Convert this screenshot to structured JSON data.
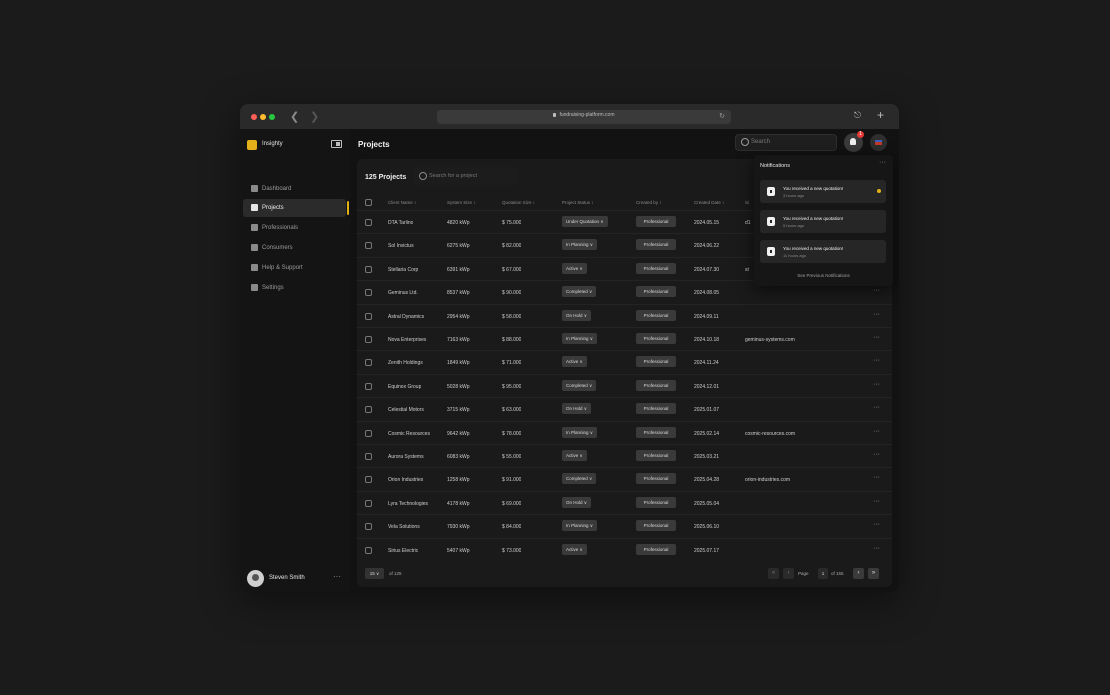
{
  "browser": {
    "url": "fundraising-platform.com"
  },
  "sidebar": {
    "brand": "Insighty",
    "items": [
      {
        "label": "Dashboard",
        "icon": "home-icon"
      },
      {
        "label": "Projects",
        "icon": "folder-icon",
        "active": true
      },
      {
        "label": "Professionals",
        "icon": "wrench-icon"
      },
      {
        "label": "Consumers",
        "icon": "users-icon"
      },
      {
        "label": "Help & Support",
        "icon": "chat-icon"
      },
      {
        "label": "Settings",
        "icon": "gear-icon"
      }
    ],
    "user": {
      "name": "Steven Smith"
    }
  },
  "header": {
    "title": "Projects",
    "search_placeholder": "Search",
    "notification_count": "1"
  },
  "projects": {
    "count_title": "125 Projects",
    "search_placeholder": "Search for a project",
    "columns": [
      "Client Name ↕",
      "System Size ↕",
      "Quotation Size ↕",
      "Project Status ↕",
      "Created by ↕",
      "Created Date ↕",
      "Si"
    ],
    "rows": [
      [
        "DTA Tarlino",
        "4820 kWp",
        "$ 75.000",
        "Under Quotation ∨",
        "Professional",
        "2024.05.15",
        "d1"
      ],
      [
        "Sol Invictus",
        "6275 kWp",
        "$ 82.000",
        "In Planning ∨",
        "Professional",
        "2024.06.22",
        ""
      ],
      [
        "Stellaria Corp",
        "6391 kWp",
        "$ 67.000",
        "Active ∨",
        "Professional",
        "2024.07.30",
        "st"
      ],
      [
        "Geminus Ltd.",
        "8537 kWp",
        "$ 90.000",
        "Completed ∨",
        "Professional",
        "2024.08.05",
        ""
      ],
      [
        "Astral Dynamics",
        "2954 kWp",
        "$ 58.000",
        "On Hold ∨",
        "Professional",
        "2024.09.11",
        ""
      ],
      [
        "Nova Enterprises",
        "7163 kWp",
        "$ 88.000",
        "In Planning ∨",
        "Professional",
        "2024.10.18",
        "geminus-systems.com"
      ],
      [
        "Zenith Holdings",
        "1849 kWp",
        "$ 71.000",
        "Active ∨",
        "Professional",
        "2024.11.24",
        ""
      ],
      [
        "Equinox Group",
        "5028 kWp",
        "$ 95.000",
        "Completed ∨",
        "Professional",
        "2024.12.01",
        ""
      ],
      [
        "Celestial Motors",
        "3715 kWp",
        "$ 63.000",
        "On Hold ∨",
        "Professional",
        "2025.01.07",
        ""
      ],
      [
        "Cosmic Resources",
        "9642 kWp",
        "$ 78.000",
        "In Planning ∨",
        "Professional",
        "2025.02.14",
        "cosmic-resources.com"
      ],
      [
        "Aurora Systems",
        "6083 kWp",
        "$ 55.000",
        "Active ∨",
        "Professional",
        "2025.03.21",
        ""
      ],
      [
        "Orion Industries",
        "1258 kWp",
        "$ 91.000",
        "Completed ∨",
        "Professional",
        "2025.04.28",
        "orion-industries.com"
      ],
      [
        "Lyra Technologies",
        "4178 kWp",
        "$ 69.000",
        "On Hold ∨",
        "Professional",
        "2025.05.04",
        ""
      ],
      [
        "Vela Solutions",
        "7930 kWp",
        "$ 84.000",
        "In Planning ∨",
        "Professional",
        "2025.06.10",
        ""
      ],
      [
        "Sirius Electric",
        "5407 kWp",
        "$ 73.000",
        "Active ∨",
        "Professional",
        "2025.07.17",
        ""
      ]
    ],
    "pagination": {
      "page_size": "15 ∨",
      "of_total": "of 125",
      "page_label": "Page",
      "current_page": "1",
      "page_total": "of 155"
    }
  },
  "notifications": {
    "title": "Notifications",
    "items": [
      {
        "message": "You received a new quotation!",
        "time": "3 hours ago",
        "unread": true
      },
      {
        "message": "You received a new quotation!",
        "time": "5 hours ago"
      },
      {
        "message": "You received a new quotation!",
        "time": "11 hours ago"
      }
    ],
    "see_previous": "See Previous Notifications"
  },
  "colors": {
    "accent": "#e2b019",
    "badge": "#e53935",
    "background": "#1b1b1b"
  }
}
